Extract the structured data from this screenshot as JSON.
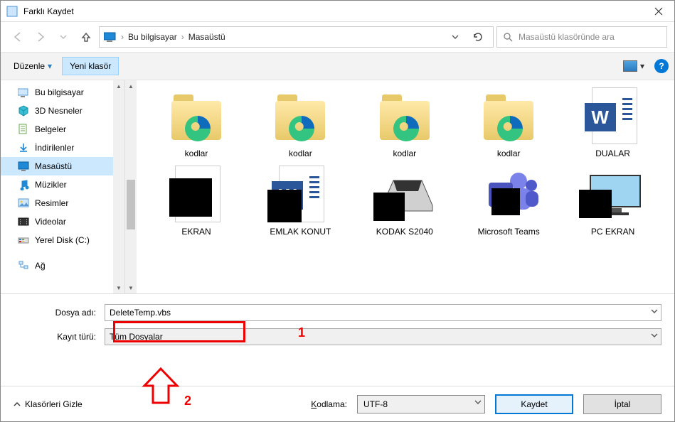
{
  "window": {
    "title": "Farklı Kaydet"
  },
  "address": {
    "crumbs": [
      "Bu bilgisayar",
      "Masaüstü"
    ]
  },
  "search": {
    "placeholder": "Masaüstü klasöründe ara"
  },
  "toolbar": {
    "organize": "Düzenle",
    "new_folder": "Yeni klasör"
  },
  "sidebar": {
    "items": [
      {
        "label": "Bu bilgisayar",
        "icon": "pc"
      },
      {
        "label": "3D Nesneler",
        "icon": "cube"
      },
      {
        "label": "Belgeler",
        "icon": "docs"
      },
      {
        "label": "İndirilenler",
        "icon": "download"
      },
      {
        "label": "Masaüstü",
        "icon": "desktop",
        "active": true
      },
      {
        "label": "Müzikler",
        "icon": "music"
      },
      {
        "label": "Resimler",
        "icon": "pictures"
      },
      {
        "label": "Videolar",
        "icon": "videos"
      },
      {
        "label": "Yerel Disk (C:)",
        "icon": "disk"
      },
      {
        "label": "Ağ",
        "icon": "network"
      }
    ]
  },
  "files": {
    "row1": [
      {
        "label": "kodlar",
        "type": "folder-edge"
      },
      {
        "label": "kodlar",
        "type": "folder-edge"
      },
      {
        "label": "kodlar",
        "type": "folder-edge"
      },
      {
        "label": "kodlar",
        "type": "folder-edge"
      },
      {
        "label": "DUALAR",
        "type": "word"
      }
    ],
    "row2": [
      {
        "label": "EKRAN",
        "type": "doc-black"
      },
      {
        "label": "EMLAK KONUT",
        "type": "word-black"
      },
      {
        "label": "KODAK S2040",
        "type": "scanner"
      },
      {
        "label": "Microsoft Teams",
        "type": "teams"
      },
      {
        "label": "PC EKRAN",
        "type": "monitor"
      }
    ]
  },
  "form": {
    "filename_label": "Dosya adı:",
    "filename_value": "DeleteTemp.vbs",
    "filetype_label": "Kayıt türü:",
    "filetype_value": "Tüm Dosyalar"
  },
  "footer": {
    "hide_folders": "Klasörleri Gizle",
    "encoding_label": "Kodlama:",
    "encoding_value": "UTF-8",
    "save": "Kaydet",
    "cancel": "İptal"
  },
  "annotations": {
    "one": "1",
    "two": "2"
  }
}
